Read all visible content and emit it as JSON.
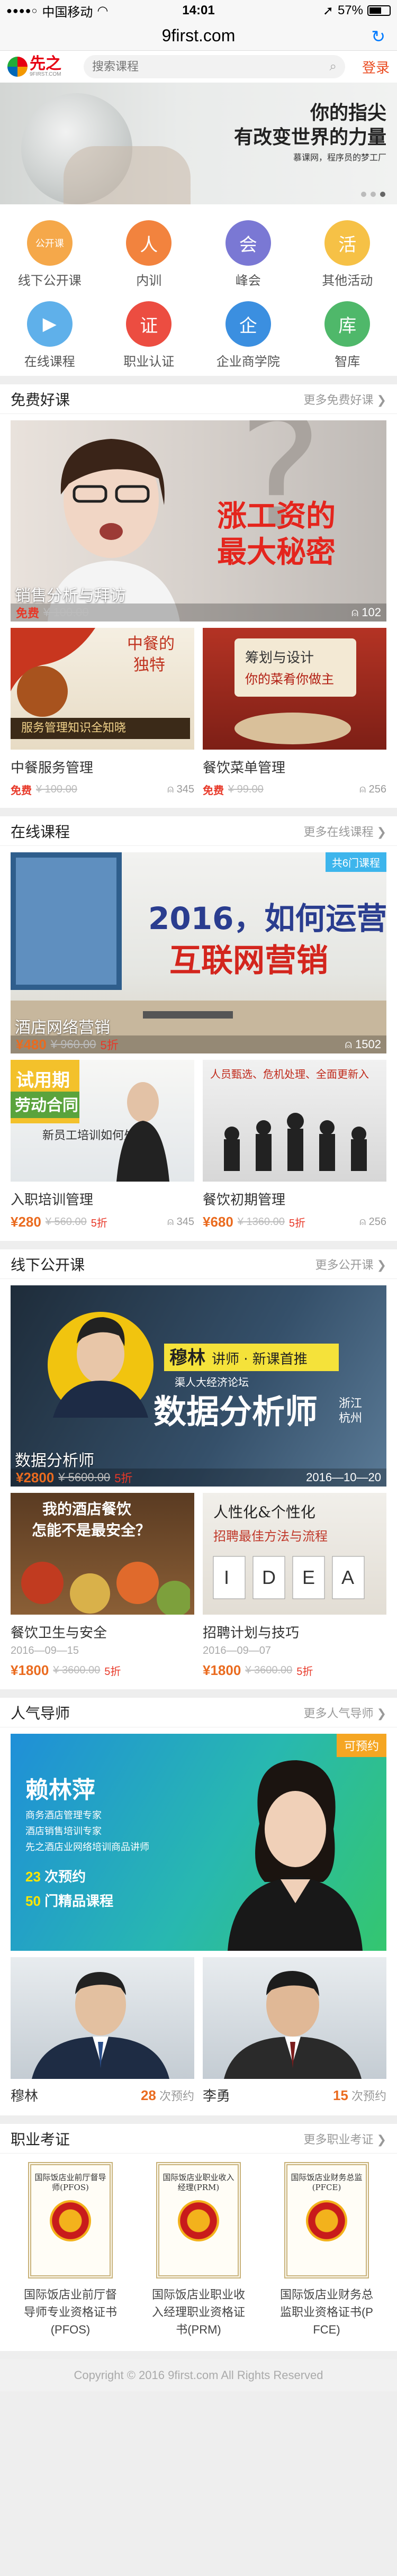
{
  "status": {
    "carrier": "中国移动",
    "time": "14:01",
    "battery": "57%"
  },
  "browser": {
    "url": "9first.com"
  },
  "header": {
    "logo_cn": "先之",
    "logo_en": "9FIRST.COM",
    "search_placeholder": "搜索课程",
    "login": "登录"
  },
  "banner": {
    "line1": "你的指尖",
    "line2": "有改变世界的力量",
    "sub": "慕课网，程序员的梦工厂"
  },
  "categories": [
    {
      "label": "线下公开课",
      "color": "#f5a84a",
      "icon": "公开课"
    },
    {
      "label": "内训",
      "color": "#f2833e",
      "icon": "人"
    },
    {
      "label": "峰会",
      "color": "#7a78d4",
      "icon": "会"
    },
    {
      "label": "其他活动",
      "color": "#f6c146",
      "icon": "活"
    },
    {
      "label": "在线课程",
      "color": "#5fb0ea",
      "icon": "▶"
    },
    {
      "label": "职业认证",
      "color": "#ec4d41",
      "icon": "证"
    },
    {
      "label": "企业商学院",
      "color": "#3b8fe0",
      "icon": "企"
    },
    {
      "label": "智库",
      "color": "#4fb86a",
      "icon": "库"
    }
  ],
  "free": {
    "title": "免费好课",
    "more": "更多免费好课 ❯",
    "hero": {
      "caption": "销售分析与拜访",
      "free": "免费",
      "orig": "¥ 100.00",
      "count": "102",
      "overlay1": "涨工资的",
      "overlay2": "最大秘密"
    },
    "cards": [
      {
        "name": "中餐服务管理",
        "free": "免费",
        "orig": "¥ 100.00",
        "count": "345",
        "t1": "中餐的",
        "t2": "独特",
        "t3": "服务管理知识全知晓"
      },
      {
        "name": "餐饮菜单管理",
        "free": "免费",
        "orig": "¥ 99.00",
        "count": "256",
        "t1": "筹划与设计",
        "t2": "你的菜肴你做主"
      }
    ]
  },
  "online": {
    "title": "在线课程",
    "more": "更多在线课程 ❯",
    "hero": {
      "caption": "酒店网络营销",
      "price": "¥480",
      "orig": "¥ 960.00",
      "disc": "5折",
      "count": "1502",
      "tag": "共6门课程",
      "o1": "2016，如何运营",
      "o2": "互联网营销"
    },
    "cards": [
      {
        "name": "入职培训管理",
        "price": "¥280",
        "orig": "¥ 560.00",
        "disc": "5折",
        "count": "345",
        "t1": "试用期",
        "t2": "劳动合同",
        "t3": "新员工培训如何处理？"
      },
      {
        "name": "餐饮初期管理",
        "price": "¥680",
        "orig": "¥ 1360.00",
        "disc": "5折",
        "count": "256",
        "t1": "人员甄选、危机处理、全面更新入"
      }
    ]
  },
  "offline": {
    "title": "线下公开课",
    "more": "更多公开课 ❯",
    "hero": {
      "caption": "数据分析师",
      "price": "¥2800",
      "orig": "¥ 5600.00",
      "disc": "5折",
      "date": "2016—10—20",
      "o1": "穆林",
      "o2": "讲师 · 新课首推",
      "o3": "数据分析师",
      "o4": "浙江",
      "o5": "杭州",
      "o6": "渠人大经济论坛"
    },
    "cards": [
      {
        "name": "餐饮卫生与安全",
        "date": "2016—09—15",
        "price": "¥1800",
        "orig": "¥ 3600.00",
        "disc": "5折",
        "t1": "我的酒店餐饮",
        "t2": "怎能不是最安全？"
      },
      {
        "name": "招聘计划与技巧",
        "date": "2016—09—07",
        "price": "¥1800",
        "orig": "¥ 3600.00",
        "disc": "5折",
        "t1": "人性化&个性化",
        "t2": "招聘最佳方法与流程"
      }
    ]
  },
  "teachers": {
    "title": "人气导师",
    "more": "更多人气导师 ❯",
    "hero": {
      "name": "赖林萍",
      "d1": "商务酒店管理专家",
      "d2": "酒店销售培训专家",
      "d3": "先之酒店业网络培训商品讲师",
      "s1": "23",
      "s1l": "次预约",
      "s2": "50",
      "s2l": "门精品课程",
      "book": "可预约"
    },
    "cards": [
      {
        "name": "穆林",
        "count": "28",
        "label": "次预约"
      },
      {
        "name": "李勇",
        "count": "15",
        "label": "次预约"
      }
    ]
  },
  "certs": {
    "title": "职业考证",
    "more": "更多职业考证 ❯",
    "items": [
      {
        "doc": "国际饭店业前厅督导师(PFOS)",
        "cap1": "国际饭店业前厅督",
        "cap2": "导师专业资格证书",
        "cap3": "(PFOS)"
      },
      {
        "doc": "国际饭店业职业收入经理(PRM)",
        "cap1": "国际饭店业职业收",
        "cap2": "入经理职业资格证",
        "cap3": "书(PRM)"
      },
      {
        "doc": "国际饭店业财务总监(PFCE)",
        "cap1": "国际饭店业财务总",
        "cap2": "监职业资格证书(P",
        "cap3": "FCE)"
      }
    ]
  },
  "footer": "Copyright © 2016 9first.com All Rights Reserved"
}
